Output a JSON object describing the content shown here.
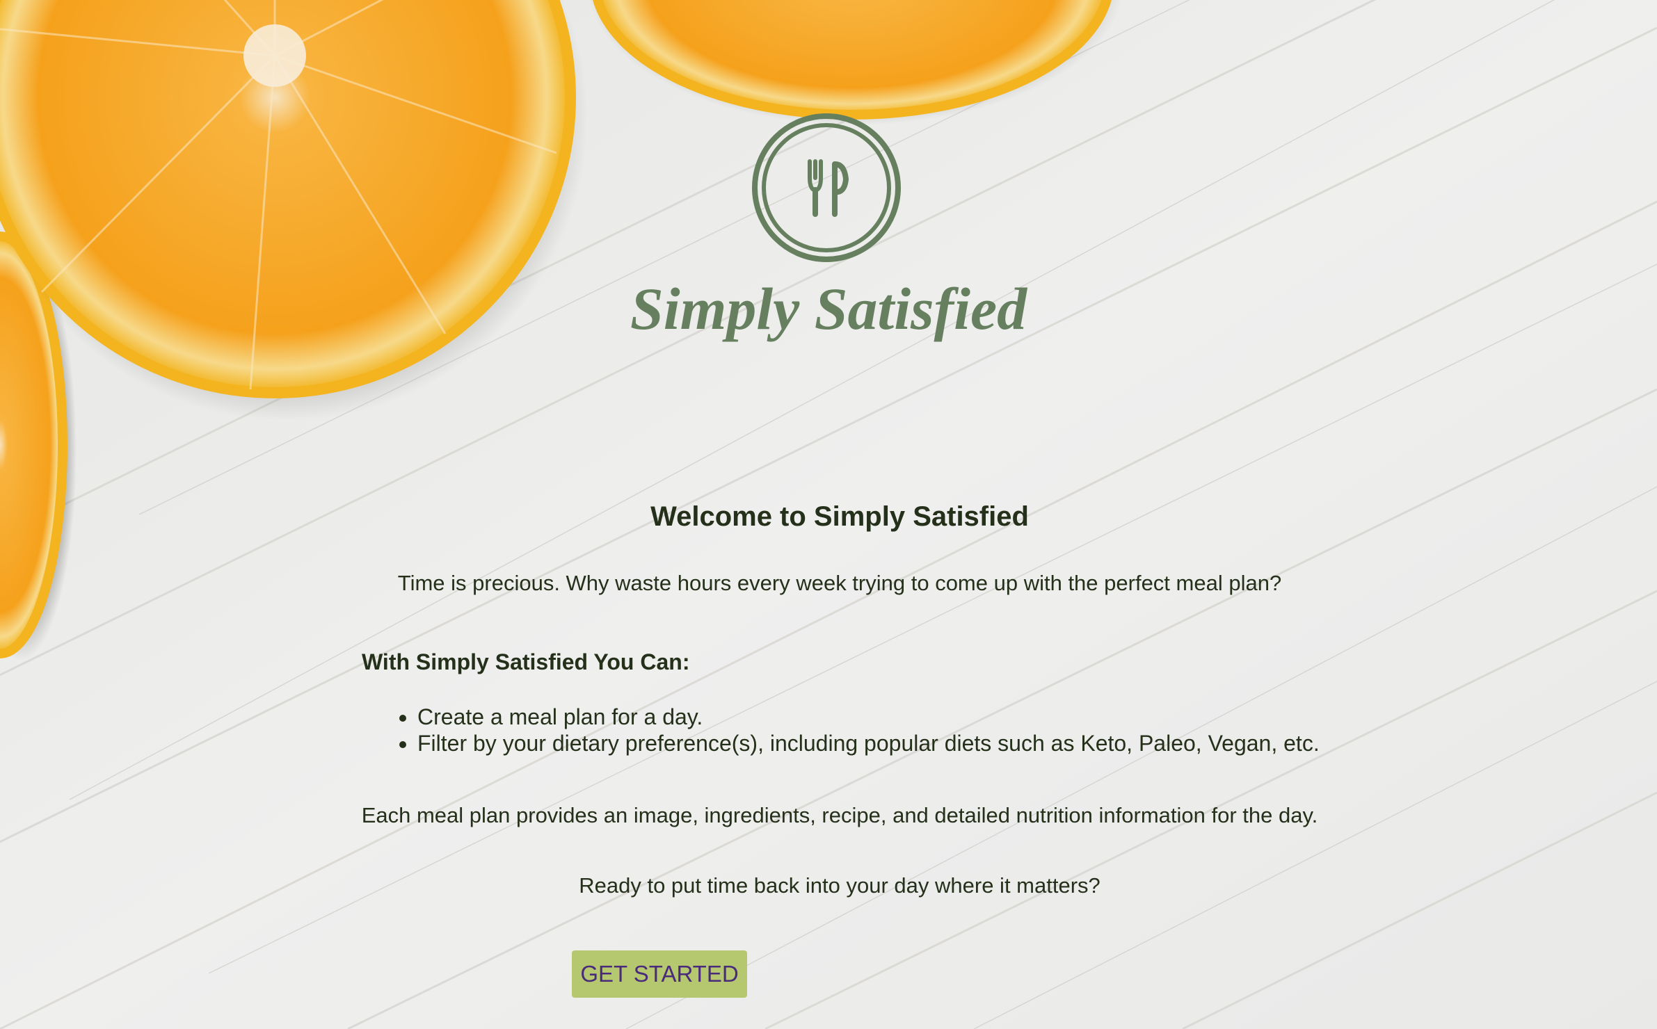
{
  "brand": {
    "name": "Simply Satisfied",
    "color": "#66805f"
  },
  "hero": {
    "welcome": "Welcome to Simply Satisfied",
    "intro": "Time is precious. Why waste hours every week trying to come up with the perfect meal plan?"
  },
  "features": {
    "heading": "With Simply Satisfied You Can:",
    "items": [
      "Create a meal plan for a day.",
      "Filter by your dietary preference(s), including popular diets such as Keto, Paleo, Vegan, etc."
    ]
  },
  "description": "Each meal plan provides an image, ingredients, recipe, and detailed nutrition information for the day.",
  "question": "Ready to put time back into your day where it matters?",
  "cta": {
    "label": "GET STARTED",
    "background": "#b5c76f",
    "text_color": "#4a2a7a"
  },
  "icons": {
    "logo": "plate-fork-spoon-icon"
  },
  "colors": {
    "text": "#25301a",
    "background": "#eceded",
    "orange": "#f6a21c"
  }
}
